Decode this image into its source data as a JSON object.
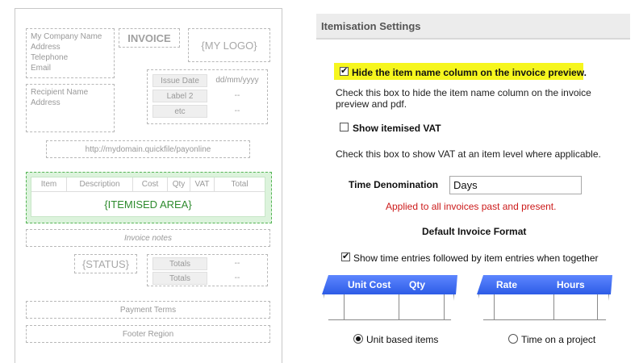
{
  "preview": {
    "company_lines": [
      "My Company Name",
      "Address",
      "Telephone",
      "Email"
    ],
    "invoice_title": "INVOICE",
    "logo": "{MY LOGO}",
    "recipient_lines": [
      "Recipient Name",
      "Address"
    ],
    "meta": [
      {
        "label": "Issue Date",
        "value": "dd/mm/yyyy"
      },
      {
        "label": "Label 2",
        "value": "--"
      },
      {
        "label": "etc",
        "value": "--"
      }
    ],
    "url": "http://mydomain.quickfile/payonline",
    "item_columns": [
      "Item",
      "Description",
      "Cost",
      "Qty",
      "VAT",
      "Total"
    ],
    "itemised_area": "{ITEMISED AREA}",
    "notes": "Invoice notes",
    "status": "{STATUS}",
    "totals": [
      {
        "label": "Totals",
        "value": "--"
      },
      {
        "label": "Totals",
        "value": "--"
      }
    ],
    "payment_terms": "Payment Terms",
    "footer_region": "Footer Region"
  },
  "settings": {
    "title": "Itemisation Settings",
    "hide_item_name": {
      "label": "Hide the item name column on the invoice preview.",
      "checked": true,
      "highlight": "#f6f61e",
      "help_line1": "Check this box to hide the item name column on the invoice",
      "help_line2": "preview and pdf."
    },
    "show_itemised_vat": {
      "label": "Show itemised VAT",
      "checked": false,
      "help": "Check this box to show VAT at an item level where applicable."
    },
    "time_denomination": {
      "label": "Time Denomination",
      "value": "Days",
      "note": "Applied to all invoices past and present."
    },
    "default_format": {
      "title": "Default Invoice Format",
      "show_time_entries_label": "Show time entries followed by item entries when together",
      "show_time_entries_checked": true,
      "unit_option": {
        "col1": "Unit Cost",
        "col2": "Qty",
        "radio_label": "Unit based items",
        "selected": true
      },
      "time_option": {
        "col1": "Rate",
        "col2": "Hours",
        "radio_label": "Time on a project",
        "selected": false
      }
    }
  },
  "colors": {
    "header_blue": "#3a67f0",
    "note_red": "#cc1a1a",
    "itemised_green": "#2e8b2e"
  }
}
